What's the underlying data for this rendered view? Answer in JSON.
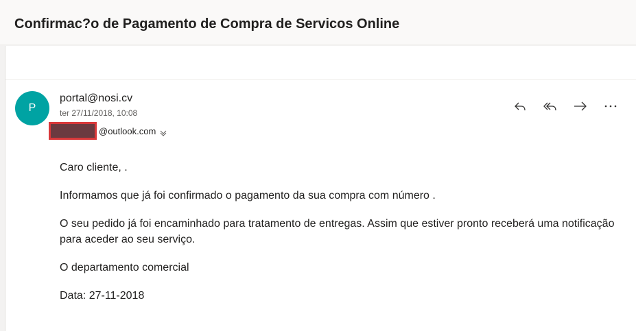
{
  "email": {
    "subject": "Confirmac?o de Pagamento de Compra de Servicos Online",
    "avatar_initial": "P",
    "sender": "portal@nosi.cv",
    "date": "ter 27/11/2018, 10:08",
    "recipient_domain": "@outlook.com",
    "body": {
      "greeting": "Caro cliente, .",
      "line1": "Informamos que já foi confirmado o pagamento da sua compra com número .",
      "line2": "O seu pedido já foi encaminhado para tratamento de entregas. Assim que estiver pronto receberá uma notificação para aceder ao seu serviço.",
      "signature": "O departamento comercial",
      "date_line": "Data: 27-11-2018"
    }
  },
  "actions": {
    "reply_icon": "reply-icon",
    "reply_all_icon": "reply-all-icon",
    "forward_icon": "forward-icon",
    "more_icon": "more-icon"
  },
  "colors": {
    "avatar": "#00a3a3",
    "redaction_fill": "#6b3a40",
    "redaction_border": "#d9383a"
  }
}
